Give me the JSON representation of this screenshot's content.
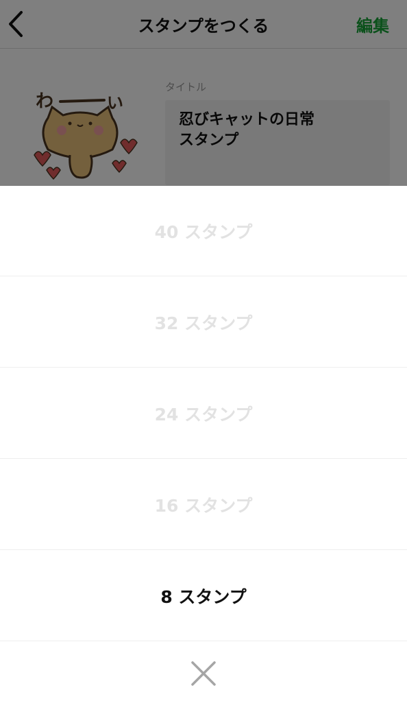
{
  "header": {
    "title": "スタンプをつくる",
    "edit_label": "編集",
    "accent_color": "#17a337"
  },
  "form": {
    "title_label": "タイトル",
    "title_value_line1": "忍びキャットの日常",
    "title_value_line2": "スタンプ"
  },
  "sticker": {
    "caption": "わ〜い"
  },
  "sheet": {
    "options": [
      {
        "label": "40 スタンプ",
        "enabled": false
      },
      {
        "label": "32 スタンプ",
        "enabled": false
      },
      {
        "label": "24 スタンプ",
        "enabled": false
      },
      {
        "label": "16 スタンプ",
        "enabled": false
      },
      {
        "label": "8 スタンプ",
        "enabled": true
      }
    ],
    "close_icon": "close-icon"
  }
}
